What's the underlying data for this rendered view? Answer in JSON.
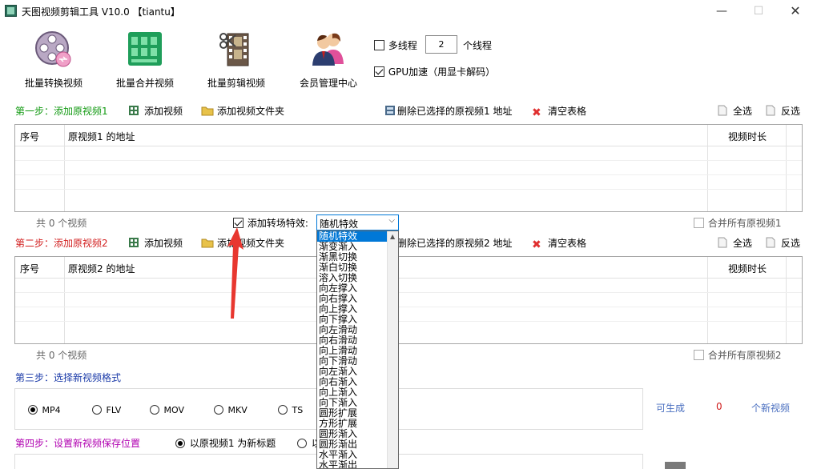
{
  "window": {
    "title": "天图视频剪辑工具 V10.0 【tiantu】",
    "minimize_glyph": "—",
    "maximize_glyph": "☐",
    "close_glyph": "✕"
  },
  "toolbar": {
    "batch_convert": "批量转换视频",
    "batch_merge": "批量合并视频",
    "batch_edit": "批量剪辑视频",
    "member_center": "会员管理中心",
    "multithread_label": "多线程",
    "thread_count": "2",
    "thread_unit": "个线程",
    "gpu_label": "GPU加速（用显卡解码）"
  },
  "step1": {
    "title": "第一步：添加原视频1",
    "add_video": "添加视频",
    "add_folder": "添加视频文件夹",
    "delete_selected": "删除已选择的原视频1 地址",
    "clear_table": "清空表格",
    "select_all": "全选",
    "invert": "反选",
    "col_index": "序号",
    "col_path": "原视频1 的地址",
    "col_duration": "视频时长",
    "count": "共 0 个视频",
    "merge_all": "合并所有原视频1"
  },
  "transition": {
    "label": "添加转场特效:",
    "selected": "随机特效",
    "options": [
      "随机特效",
      "渐变渐入",
      "渐黑切换",
      "渐白切换",
      "溶入切换",
      "向左撑入",
      "向右撑入",
      "向上撑入",
      "向下撑入",
      "向左滑动",
      "向右滑动",
      "向上滑动",
      "向下滑动",
      "向左渐入",
      "向右渐入",
      "向上渐入",
      "向下渐入",
      "圆形扩展",
      "方形扩展",
      "圆形渐入",
      "圆形渐出",
      "水平渐入",
      "水平渐出"
    ]
  },
  "step2": {
    "title": "第二步：添加原视频2",
    "add_video": "添加视频",
    "add_folder": "添加视频文件夹",
    "delete_selected": "删除已选择的原视频2 地址",
    "clear_table": "清空表格",
    "select_all": "全选",
    "invert": "反选",
    "col_index": "序号",
    "col_path": "原视频2 的地址",
    "col_duration": "视频时长",
    "count": "共 0 个视频",
    "merge_all": "合并所有原视频2"
  },
  "step3": {
    "title": "第三步：选择新视频格式",
    "formats": [
      "MP4",
      "FLV",
      "MOV",
      "MKV",
      "TS"
    ],
    "selected_format": "MP4",
    "can_generate": "可生成",
    "generate_count": "0",
    "new_videos": "个新视频"
  },
  "step4": {
    "title": "第四步：设置新视频保存位置",
    "option1": "以原视频1 为新标题",
    "option2_partial": "以"
  },
  "colors": {
    "accent_blue": "#0078d7",
    "step_green": "#129a12",
    "step_red": "#d22020",
    "step_blue": "#1a3aa8",
    "step_purple": "#b000b0",
    "arrow_red": "#e8372f"
  }
}
